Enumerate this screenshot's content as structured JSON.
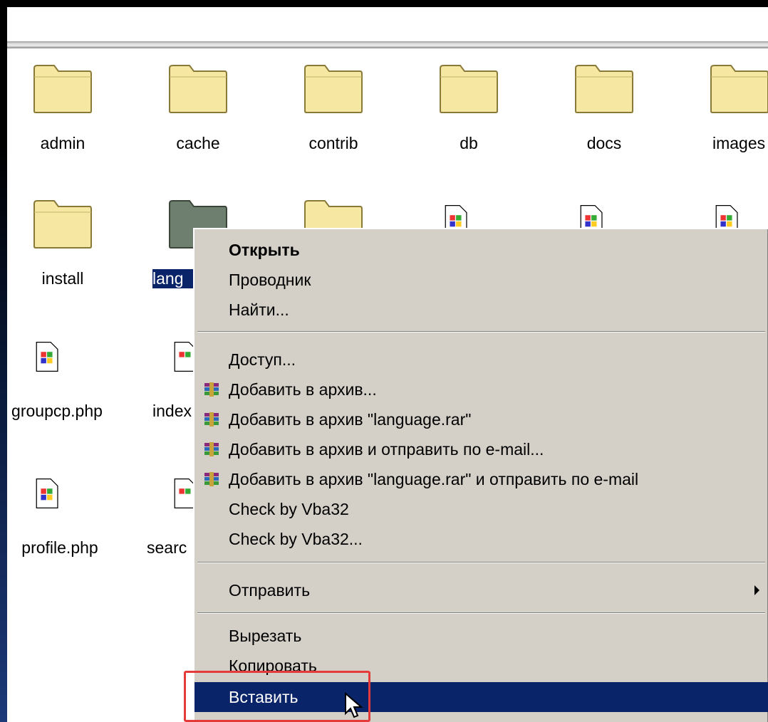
{
  "window": {
    "folders_row1": [
      "admin",
      "cache",
      "contrib",
      "db",
      "docs",
      "images"
    ],
    "folders_row2": [
      "install",
      "lang",
      ""
    ],
    "files": [
      "groupcp.php",
      "index",
      "profile.php",
      "searc"
    ]
  },
  "context_menu": {
    "items": {
      "open": "Открыть",
      "explorer": "Проводник",
      "find": "Найти...",
      "sharing": "Доступ...",
      "add_archive": "Добавить в архив...",
      "add_language_rar": "Добавить в архив \"language.rar\"",
      "add_archive_email": "Добавить в архив и отправить по e-mail...",
      "add_language_rar_email": "Добавить в архив \"language.rar\" и отправить по e-mail",
      "check_vba32": "Check by Vba32",
      "check_vba32_dots": "Check by Vba32...",
      "send_to": "Отправить",
      "cut": "Вырезать",
      "copy": "Копировать",
      "paste": "Вставить"
    }
  },
  "colors": {
    "menu_bg": "#d4d0c8",
    "highlight": "#0a246a",
    "folder_yellow": "#f7e9a0",
    "annotation_red": "#e53a3a"
  }
}
